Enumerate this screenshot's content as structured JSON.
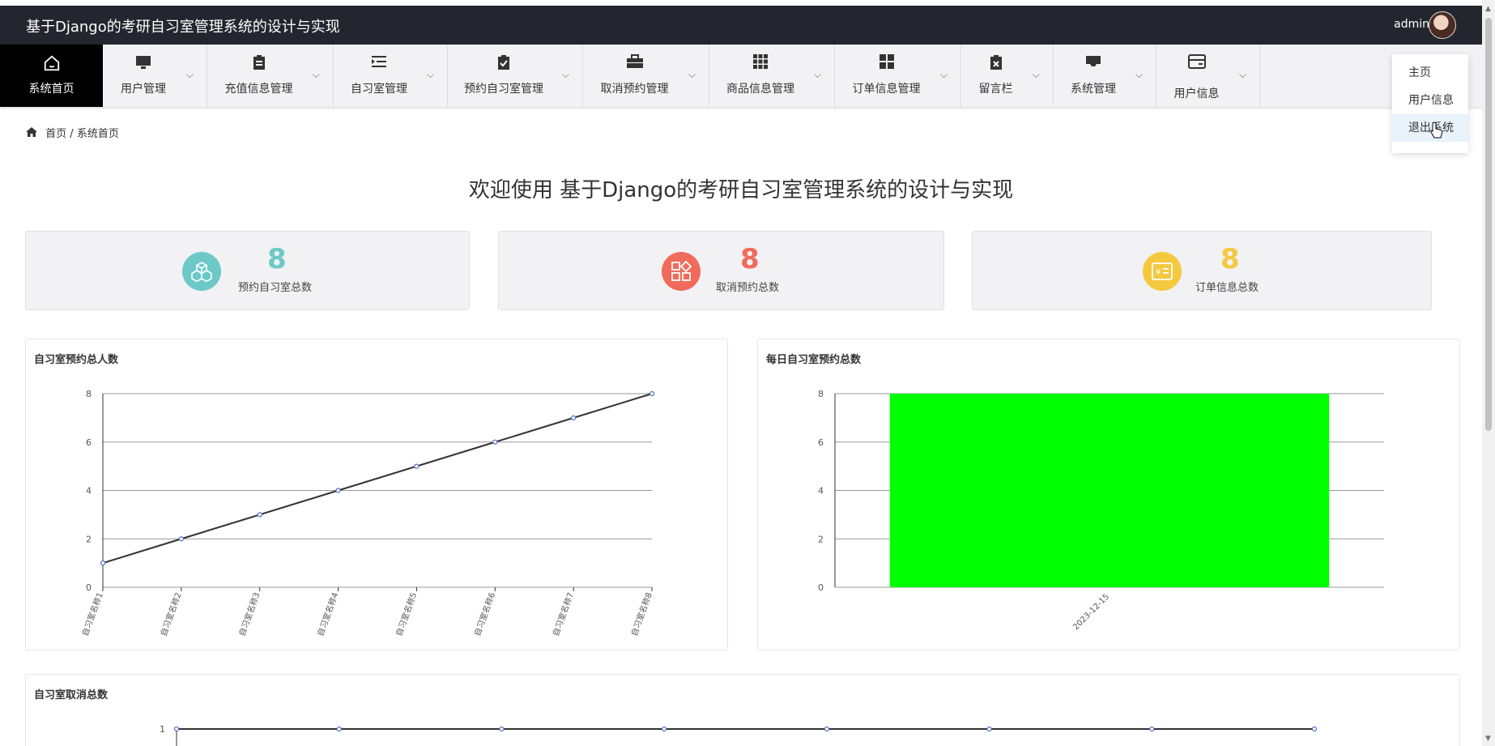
{
  "app": {
    "title": "基于Django的考研自习室管理系统的设计与实现",
    "user": "admin"
  },
  "nav": {
    "home": {
      "label": "系统首页",
      "icon": "home-icon"
    },
    "items": [
      {
        "label": "用户管理",
        "icon": "monitor-icon"
      },
      {
        "label": "充值信息管理",
        "icon": "clipboard-icon"
      },
      {
        "label": "自习室管理",
        "icon": "indent-icon"
      },
      {
        "label": "预约自习室管理",
        "icon": "clipboard-check-icon"
      },
      {
        "label": "取消预约管理",
        "icon": "briefcase-icon"
      },
      {
        "label": "商品信息管理",
        "icon": "grid-icon"
      },
      {
        "label": "订单信息管理",
        "icon": "apps-icon"
      },
      {
        "label": "留言栏",
        "icon": "clipboard-x-icon"
      },
      {
        "label": "系统管理",
        "icon": "inbox-icon"
      },
      {
        "label": "用户信息",
        "icon": "card-icon"
      }
    ]
  },
  "user_menu": {
    "items": [
      "主页",
      "用户信息",
      "退出系统"
    ]
  },
  "breadcrumb": {
    "home": "首页",
    "sep": "/",
    "current": "系统首页"
  },
  "welcome": "欢迎使用 基于Django的考研自习室管理系统的设计与实现",
  "stats": [
    {
      "value": "8",
      "label": "预约自习室总数",
      "color": "#6cc9c8",
      "icon": "cubes-icon"
    },
    {
      "value": "8",
      "label": "取消预约总数",
      "color": "#f06b5b",
      "icon": "shapes-icon"
    },
    {
      "value": "8",
      "label": "订单信息总数",
      "color": "#f4c93f",
      "icon": "invoice-icon"
    }
  ],
  "chart_data": [
    {
      "type": "line",
      "title": "自习室预约总人数",
      "categories": [
        "自习室名称1",
        "自习室名称2",
        "自习室名称3",
        "自习室名称4",
        "自习室名称5",
        "自习室名称6",
        "自习室名称7",
        "自习室名称8"
      ],
      "values": [
        1,
        2,
        3,
        4,
        5,
        6,
        7,
        8
      ],
      "yticks": [
        0,
        2,
        4,
        6,
        8
      ],
      "ylim": [
        0,
        8
      ],
      "grid": true,
      "line_color": "#333333",
      "point_color": "#5470c6"
    },
    {
      "type": "bar",
      "title": "每日自习室预约总数",
      "categories": [
        "2023-12-15"
      ],
      "values": [
        8
      ],
      "yticks": [
        0,
        2,
        4,
        6,
        8
      ],
      "ylim": [
        0,
        8
      ],
      "grid": true,
      "bar_color": "#00ff00"
    },
    {
      "type": "line",
      "title": "自习室取消总数",
      "categories": [
        "",
        "",
        "",
        "",
        "",
        "",
        "",
        ""
      ],
      "values": [
        1,
        1,
        1,
        1,
        1,
        1,
        1,
        1
      ],
      "yticks": [
        1
      ],
      "grid": true,
      "line_color": "#333333",
      "point_color": "#5470c6"
    }
  ]
}
